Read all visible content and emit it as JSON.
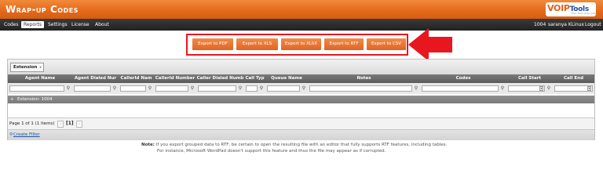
{
  "app": {
    "title": "Wrap-up Codes",
    "logo_voip": "VOIP",
    "logo_tools": "Tools",
    "logo_tagline": "Your Tools of Success"
  },
  "nav": {
    "items": [
      "Codes",
      "Reports",
      "Settings",
      "License",
      "About"
    ],
    "active": "Reports",
    "extension": "1004",
    "user": "saranya KLinux",
    "logout": "Logout"
  },
  "export": {
    "buttons": [
      "Export to PDF",
      "Export to XLS",
      "Export to XLSX",
      "Export to RTF",
      "Export to CSV"
    ],
    "highlight_color": "#e8171f"
  },
  "grid": {
    "group_by_chip": "Extension",
    "columns": [
      "Agent Name",
      "Agent Dialed Nur",
      "CallerId Nam",
      "CallerId Number",
      "Caller Dialed Numb",
      "Call Typ",
      "Queue Name",
      "Notes",
      "Codes",
      "Call Start",
      "Call End"
    ],
    "group_row_label": "Extension: 1004",
    "group_row_toggle": "+"
  },
  "pager": {
    "summary": "Page 1 of 1 (1 items)",
    "current_page": "[1]",
    "prev": "‹",
    "next": "›"
  },
  "filter": {
    "create_label": "Create Filter"
  },
  "note": {
    "label": "Note:",
    "line1": "If you export grouped data to RTF, be certain to open the resulting file with an editor that fully supports RTF features, including tables.",
    "line2": "For instance, Microsoft WordPad doesn't support this feature and thus the file may appear as if corrupted."
  },
  "colors": {
    "header": "#e56a1c",
    "navbar": "#2b2b2b",
    "export_button": "#e8752f",
    "link": "#1a55a8"
  }
}
